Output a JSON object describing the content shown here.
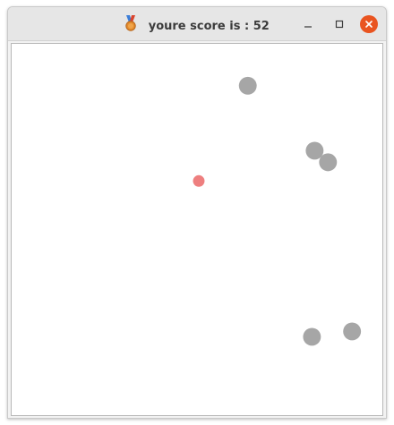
{
  "window": {
    "title": "youre score is : 52",
    "title_icon": "medal-icon",
    "controls": {
      "minimize_icon": "minimize-icon",
      "maximize_icon": "maximize-icon",
      "close_icon": "close-icon"
    },
    "colors": {
      "close_button": "#e95420",
      "titlebar": "#e6e6e6"
    }
  },
  "game": {
    "score": 52,
    "background_color": "#ffffff",
    "enemy_color": "#a6a6a6",
    "player_color": "#ee7f7f"
  }
}
